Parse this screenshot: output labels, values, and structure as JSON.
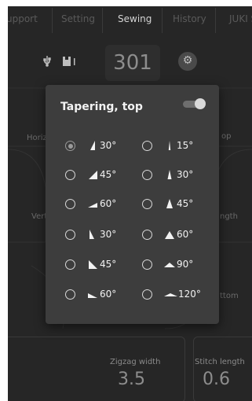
{
  "tabs": [
    {
      "label": "upport",
      "active": false
    },
    {
      "label": "Setting",
      "active": false
    },
    {
      "label": "Sewing",
      "active": true
    },
    {
      "label": "History",
      "active": false
    },
    {
      "label": "JUKI S",
      "active": false
    }
  ],
  "toolbar": {
    "counter": "301",
    "usb_icon": "usb-icon",
    "memory_icon": "memory-card-icon",
    "settings_icon": "gear-icon"
  },
  "background_labels": {
    "horiz": "Horiz",
    "top_right": "op",
    "vert": "Vert",
    "length_right": "ngth",
    "bottom_right": "ttom"
  },
  "bottom": {
    "zigzag_width_label": "Zigzag width",
    "zigzag_width_value": "3.5",
    "stitch_length_label": "Stitch length",
    "stitch_length_value": "0.6"
  },
  "dialog": {
    "title": "Tapering, top",
    "toggle_on": true,
    "options_left": [
      {
        "label": "30°",
        "selected": true,
        "shape": "tall-right-triangle"
      },
      {
        "label": "45°",
        "selected": false,
        "shape": "right-triangle"
      },
      {
        "label": "60°",
        "selected": false,
        "shape": "flat-right-triangle"
      },
      {
        "label": "30°",
        "selected": false,
        "shape": "tall-left-triangle"
      },
      {
        "label": "45°",
        "selected": false,
        "shape": "left-triangle"
      },
      {
        "label": "60°",
        "selected": false,
        "shape": "flat-left-triangle"
      }
    ],
    "options_right": [
      {
        "label": "15°",
        "selected": false,
        "shape": "needle-triangle"
      },
      {
        "label": "30°",
        "selected": false,
        "shape": "narrow-triangle"
      },
      {
        "label": "45°",
        "selected": false,
        "shape": "isosceles-triangle"
      },
      {
        "label": "60°",
        "selected": false,
        "shape": "wide-triangle"
      },
      {
        "label": "90°",
        "selected": false,
        "shape": "flat-triangle"
      },
      {
        "label": "120°",
        "selected": false,
        "shape": "very-flat-triangle"
      }
    ],
    "colors": {
      "background": "#3d3d3d",
      "text": "#f2f2f2",
      "radio": "#d8d8d8"
    }
  }
}
